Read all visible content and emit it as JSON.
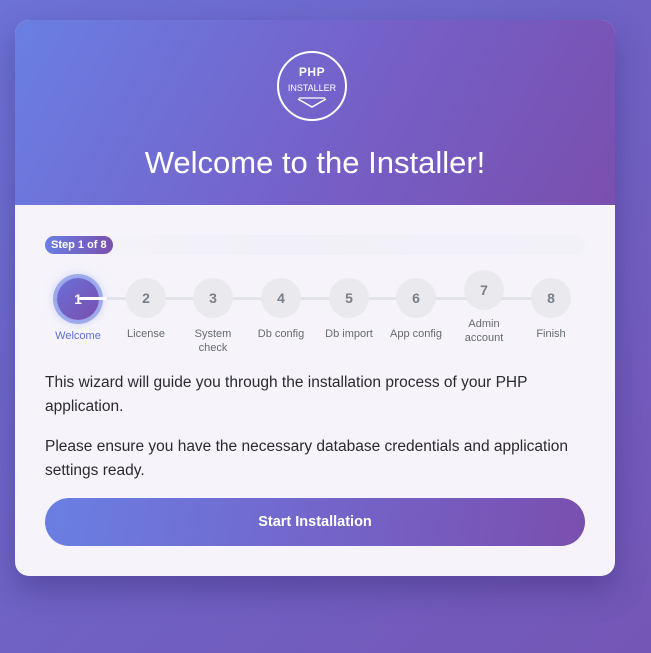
{
  "header": {
    "logo_text": "PHP",
    "logo_subtext": "INSTALLER",
    "title": "Welcome to the Installer!"
  },
  "progress": {
    "badge": "Step 1 of 8",
    "current_step": 1,
    "total_steps": 8
  },
  "steps": [
    {
      "number": "1",
      "label": "Welcome"
    },
    {
      "number": "2",
      "label": "License"
    },
    {
      "number": "3",
      "label": "System check"
    },
    {
      "number": "4",
      "label": "Db config"
    },
    {
      "number": "5",
      "label": "Db import"
    },
    {
      "number": "6",
      "label": "App config"
    },
    {
      "number": "7",
      "label": "Admin account"
    },
    {
      "number": "8",
      "label": "Finish"
    }
  ],
  "content": {
    "paragraph1": "This wizard will guide you through the installation process of your PHP application.",
    "paragraph2": "Please ensure you have the necessary database credentials and application settings ready.",
    "start_button": "Start Installation"
  },
  "colors": {
    "gradient_start": "#6a7fe3",
    "gradient_end": "#7a4fae",
    "active_label": "#5b6fd6"
  }
}
